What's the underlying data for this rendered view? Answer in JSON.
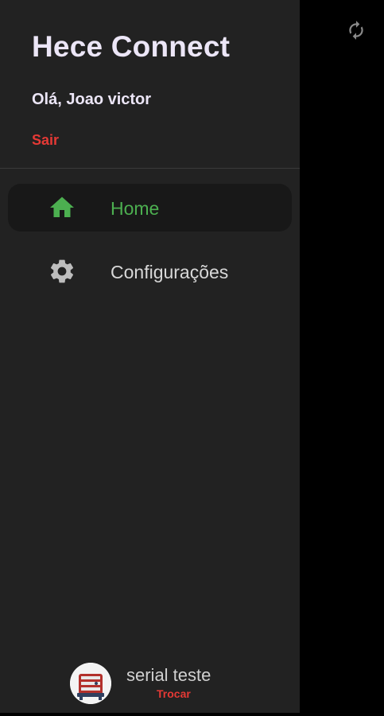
{
  "drawer": {
    "header": {
      "title": "Hece Connect",
      "greeting": "Olá, Joao victor",
      "logout_label": "Sair"
    },
    "nav_items": [
      {
        "label": "Home",
        "icon": "home-icon",
        "active": true
      },
      {
        "label": "Configurações",
        "icon": "gear-icon",
        "active": false
      }
    ],
    "footer": {
      "device_name": "serial teste",
      "switch_label": "Trocar"
    }
  },
  "background": {
    "refresh_icon": "refresh-icon"
  },
  "colors": {
    "drawer_bg": "#222222",
    "active_nav_bg": "#181818",
    "accent_green": "#4caf50",
    "danger_red": "#e53935",
    "title_text": "#ece6f7",
    "icon_gray": "#bdbdbd"
  }
}
